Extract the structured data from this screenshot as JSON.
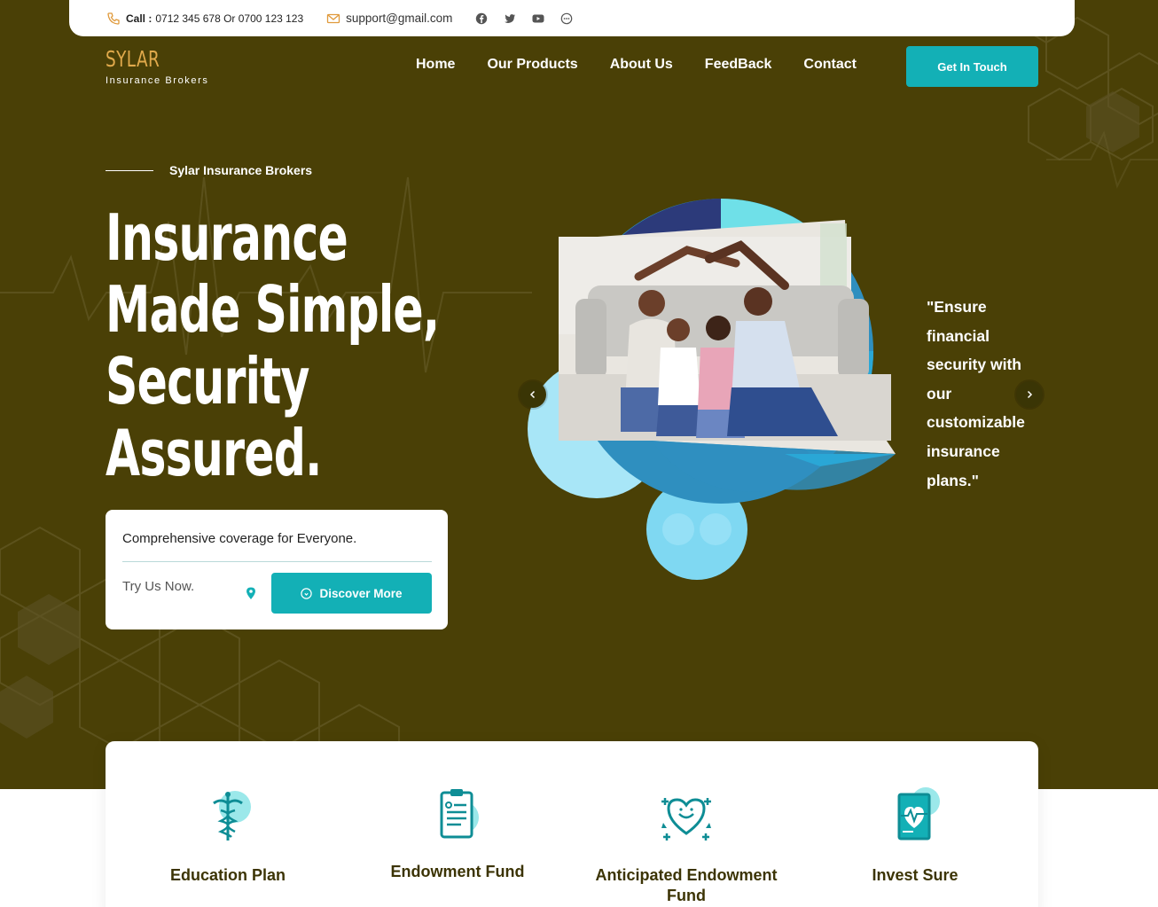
{
  "topbar": {
    "call_label": "Call :",
    "phones": "0712 345 678 Or 0700 123 123",
    "email": "support@gmail.com",
    "social_icons": [
      "facebook-icon",
      "twitter-icon",
      "youtube-icon",
      "chat-icon"
    ]
  },
  "brand": {
    "name": "SYLAR",
    "tagline": "Insurance Brokers"
  },
  "nav": {
    "items": [
      "Home",
      "Our Products",
      "About Us",
      "FeedBack",
      "Contact"
    ],
    "cta": "Get In Touch"
  },
  "hero": {
    "kicker": "Sylar Insurance Brokers",
    "headline": [
      "Insurance",
      "Made Simple,",
      "Security",
      "Assured."
    ],
    "card_title": "Comprehensive coverage for Everyone.",
    "card_prompt": "Try Us Now.",
    "discover_button": "Discover More",
    "quote": "\"Ensure financial security with our customizable insurance plans.\"",
    "image_alt": "Family sitting on the floor in front of a couch under a roof gesture"
  },
  "features": [
    {
      "title": "Education Plan",
      "icon": "caduceus-icon"
    },
    {
      "title": "Endowment Fund",
      "icon": "clipboard-icon"
    },
    {
      "title": "Anticipated Endowment Fund",
      "icon": "heart-care-icon"
    },
    {
      "title": "Invest Sure",
      "icon": "heart-monitor-icon"
    }
  ],
  "colors": {
    "hero_bg": "#4a4006",
    "accent": "#13b0b6",
    "brand": "#e0a94b",
    "feature_title": "#3c3405"
  }
}
